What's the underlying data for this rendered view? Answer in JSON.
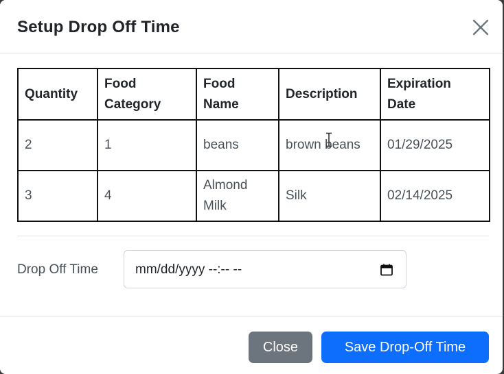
{
  "modal": {
    "title": "Setup Drop Off Time",
    "close_icon": "close-icon"
  },
  "table": {
    "headers": [
      "Quantity",
      "Food Category",
      "Food Name",
      "Description",
      "Expiration Date"
    ],
    "rows": [
      [
        "2",
        "1",
        "beans",
        "brown beans",
        "01/29/2025"
      ],
      [
        "3",
        "4",
        "Almond Milk",
        "Silk",
        "02/14/2025"
      ]
    ]
  },
  "drop_off": {
    "label": "Drop Off Time",
    "placeholder": "mm/dd/yyyy --:-- --",
    "icon": "calendar-icon"
  },
  "footer": {
    "close_label": "Close",
    "save_label": "Save Drop-Off Time"
  },
  "colors": {
    "primary": "#0d6efd",
    "secondary": "#6c757d",
    "border": "#dee2e6"
  }
}
